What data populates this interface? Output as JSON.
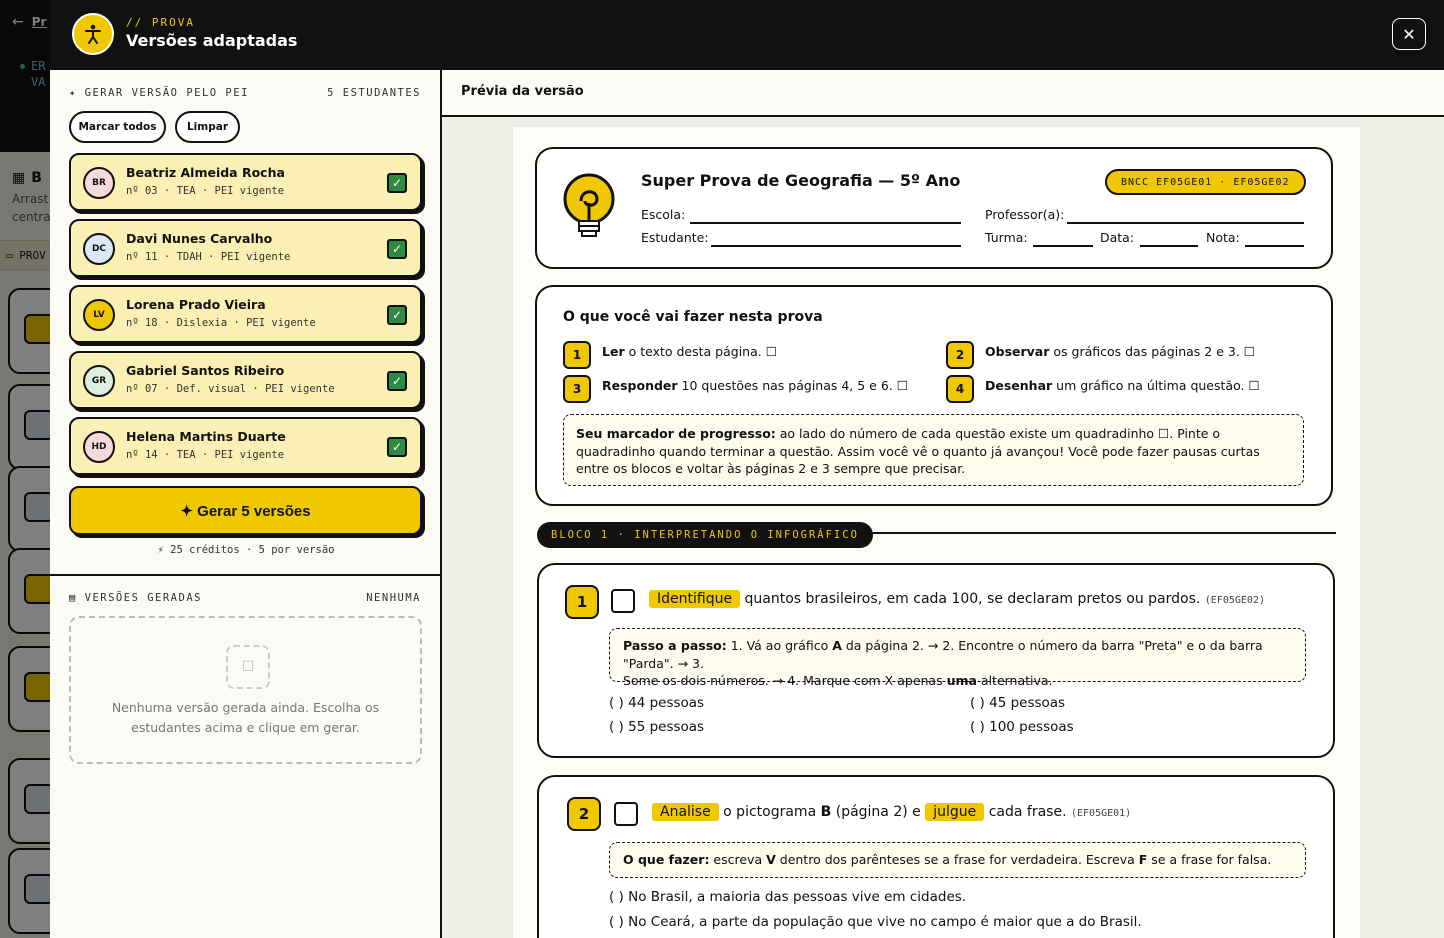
{
  "background": {
    "back_link": "Pr",
    "status_line1": "ER",
    "status_line2": "VA",
    "title": "B",
    "sub_line1": "Arrast",
    "sub_line2": "centra",
    "tab_label": "PROV"
  },
  "header": {
    "kicker": "// PROVA",
    "title": "Versões adaptadas",
    "close_glyph": "✕"
  },
  "pei": {
    "section_label": "✦ GERAR VERSÃO PELO PEI",
    "count_label": "5 ESTUDANTES",
    "mark_all": "Marcar todos",
    "clear": "Limpar",
    "students": [
      {
        "initials": "BR",
        "name": "Beatriz Almeida Rocha",
        "meta": "nº 03 · TEA · PEI vigente",
        "avatar_color": "#f7d9dc"
      },
      {
        "initials": "DC",
        "name": "Davi Nunes Carvalho",
        "meta": "nº 11 · TDAH · PEI vigente",
        "avatar_color": "#d8e9f7"
      },
      {
        "initials": "LV",
        "name": "Lorena Prado Vieira",
        "meta": "nº 18 · Dislexia · PEI vigente",
        "avatar_color": "#f0c800"
      },
      {
        "initials": "GR",
        "name": "Gabriel Santos Ribeiro",
        "meta": "nº 07 · Def. visual · PEI vigente",
        "avatar_color": "#dcefe0"
      },
      {
        "initials": "HD",
        "name": "Helena Martins Duarte",
        "meta": "nº 14 · TEA · PEI vigente",
        "avatar_color": "#f7d9dc"
      }
    ],
    "generate_button": "✦ Gerar 5 versões",
    "credits": "⚡ 25 créditos · 5 por versão"
  },
  "versions": {
    "section_label": "▤ VERSÕES GERADAS",
    "count_label": "NENHUMA",
    "empty_icon": "☐",
    "empty_text": "Nenhuma versão gerada ainda. Escolha os estudantes acima e clique em gerar."
  },
  "preview": {
    "header": "Prévia da versão",
    "exam_title": "Super Prova de Geografia — 5º Ano",
    "bncc": "BNCC EF05GE01 · EF05GE02",
    "fields": {
      "school": "Escola:",
      "teacher": "Professor(a):",
      "student": "Estudante:",
      "class": "Turma:",
      "date": "Data:",
      "grade": "Nota:"
    },
    "intro": {
      "title": "O que você vai fazer nesta prova",
      "steps": [
        {
          "num": "1",
          "bold": "Ler",
          "rest": " o texto desta página. ☐"
        },
        {
          "num": "2",
          "bold": "Observar",
          "rest": " os gráficos das páginas 2 e 3. ☐"
        },
        {
          "num": "3",
          "bold": "Responder",
          "rest": " 10 questões nas páginas 4, 5 e 6. ☐"
        },
        {
          "num": "4",
          "bold": "Desenhar",
          "rest": " um gráfico na última questão. ☐"
        }
      ],
      "note_bold": "Seu marcador de progresso:",
      "note_rest": " ao lado do número de cada questão existe um quadradinho ☐. Pinte o quadradinho quando terminar a questão. Assim você vê o quanto já avançou! Você pode fazer pausas curtas entre os blocos e voltar às páginas 2 e 3 sempre que precisar."
    },
    "block1_label": "BLOCO 1 · INTERPRETANDO O INFOGRÁFICO",
    "q1": {
      "num": "1",
      "verb": "Identifique",
      "text": " quantos brasileiros, em cada 100, se declaram pretos ou pardos.",
      "code": "(EF05GE02)",
      "hint_bold": "Passo a passo:",
      "hint_l1_a": " 1. Vá ao gráfico ",
      "hint_l1_b": "A",
      "hint_l1_c": " da página 2. → 2. Encontre o número da barra \"Preta\" e o da barra \"Parda\". → 3.",
      "hint_l2_a": "Some os dois números. → 4. Marque com X apenas ",
      "hint_l2_b": "uma",
      "hint_l2_c": " alternativa.",
      "options": [
        "(   ) 44 pessoas",
        "(   ) 45 pessoas",
        "(   ) 55 pessoas",
        "(   ) 100 pessoas"
      ]
    },
    "q2": {
      "num": "2",
      "verb1": "Analise",
      "text1": " o pictograma ",
      "bold_b": "B",
      "text2": " (página 2) e ",
      "verb2": "julgue",
      "text3": " cada frase.",
      "code": "(EF05GE01)",
      "hint_bold": "O que fazer:",
      "hint_a": " escreva ",
      "hint_v": "V",
      "hint_b": " dentro dos parênteses se a frase for verdadeira. Escreva ",
      "hint_f": "F",
      "hint_c": " se a frase for falsa.",
      "items": [
        "(   ) No Brasil, a maioria das pessoas vive em cidades.",
        "(   ) No Ceará, a parte da população que vive no campo é maior que a do Brasil."
      ]
    }
  }
}
